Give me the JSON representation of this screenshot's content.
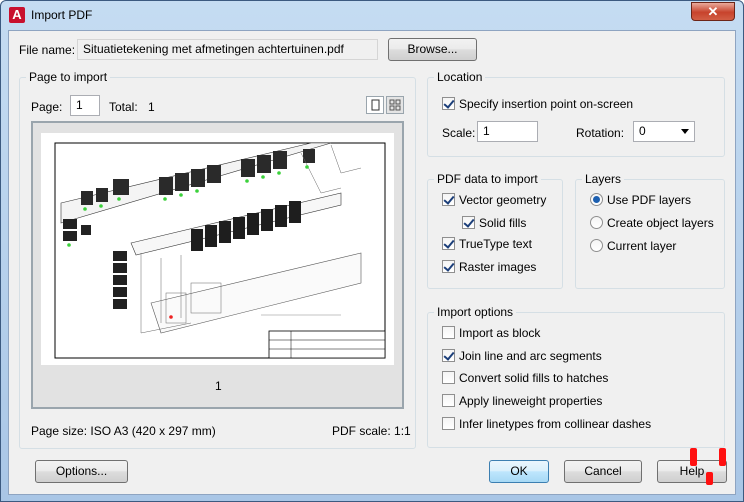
{
  "window": {
    "title": "Import PDF",
    "close_glyph": "✕",
    "app_icon_letter": "A"
  },
  "file": {
    "label": "File name:",
    "value": "Situatietekening met afmetingen achtertuinen.pdf",
    "browse_label": "Browse..."
  },
  "page_to_import": {
    "title": "Page to import",
    "page_label": "Page:",
    "page_value": "1",
    "total_label": "Total:",
    "total_value": "1",
    "thumbnail_page_number": "1",
    "page_size_text": "Page size: ISO A3 (420 x 297 mm)",
    "pdf_scale_text": "PDF scale: 1:1",
    "view_icons": [
      "single-page-view-icon",
      "thumbnail-grid-view-icon"
    ]
  },
  "location": {
    "title": "Location",
    "specify_label": "Specify insertion point on-screen",
    "specify_checked": true,
    "scale_label": "Scale:",
    "scale_value": "1",
    "rotation_label": "Rotation:",
    "rotation_value": "0"
  },
  "pdf_data": {
    "title": "PDF data to import",
    "items": [
      {
        "label": "Vector geometry",
        "checked": true
      },
      {
        "label": "Solid fills",
        "checked": true
      },
      {
        "label": "TrueType text",
        "checked": true
      },
      {
        "label": "Raster images",
        "checked": true
      }
    ]
  },
  "layers": {
    "title": "Layers",
    "options": [
      {
        "label": "Use PDF layers",
        "selected": true
      },
      {
        "label": "Create object layers",
        "selected": false
      },
      {
        "label": "Current layer",
        "selected": false
      }
    ]
  },
  "import_options": {
    "title": "Import options",
    "items": [
      {
        "label": "Import as block",
        "checked": false
      },
      {
        "label": "Join line and arc segments",
        "checked": true
      },
      {
        "label": "Convert solid fills to hatches",
        "checked": false
      },
      {
        "label": "Apply lineweight properties",
        "checked": false
      },
      {
        "label": "Infer linetypes from collinear dashes",
        "checked": false
      }
    ]
  },
  "buttons": {
    "options": "Options...",
    "ok": "OK",
    "cancel": "Cancel",
    "help": "Help"
  },
  "colors": {
    "title_gradient_top": "#c5dcf2",
    "dialog_bg": "#f0f0f0",
    "close_red": "#c7432c",
    "marker_red": "#ff1010"
  }
}
